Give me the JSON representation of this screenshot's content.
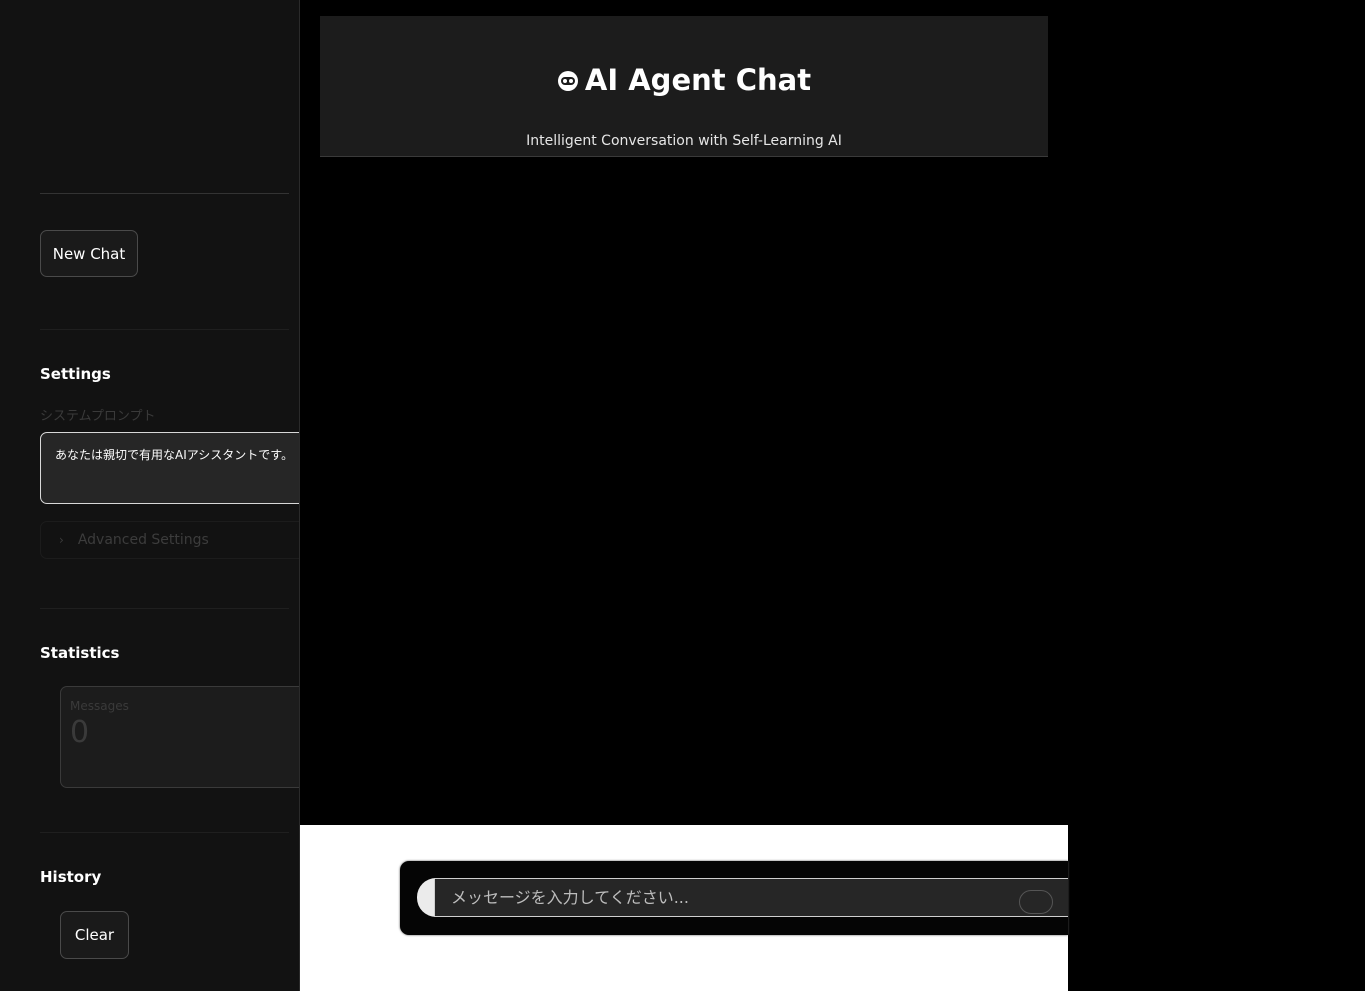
{
  "sidebar": {
    "new_chat_label": "New Chat",
    "settings": {
      "heading": "Settings",
      "prompt_label": "システムプロンプト",
      "prompt_value": "あなたは親切で有用なAIアシスタントです。",
      "advanced_label": "Advanced Settings"
    },
    "statistics": {
      "heading": "Statistics",
      "messages_label": "Messages",
      "messages_value": "0"
    },
    "history": {
      "heading": "History",
      "clear_label": "Clear"
    }
  },
  "header": {
    "title": "AI Agent Chat",
    "title_icon": "robot-icon",
    "subtitle": "Intelligent Conversation with Self-Learning AI"
  },
  "chat": {
    "placeholder": "メッセージを入力してください..."
  }
}
